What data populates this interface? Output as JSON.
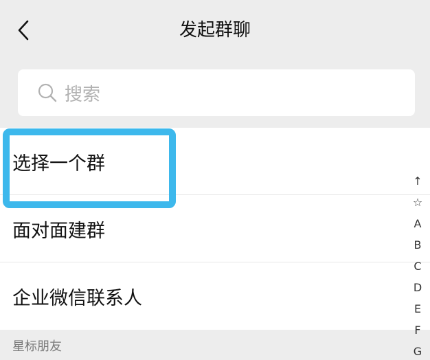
{
  "nav": {
    "title": "发起群聊"
  },
  "search": {
    "placeholder": "搜索"
  },
  "menu_items": [
    {
      "label": "选择一个群"
    },
    {
      "label": "面对面建群"
    },
    {
      "label": "企业微信联系人"
    }
  ],
  "section": {
    "title": "星标朋友"
  },
  "index": [
    "↑",
    "☆",
    "A",
    "B",
    "C",
    "D",
    "E",
    "F",
    "G"
  ],
  "colors": {
    "background": "#ededed",
    "highlight": "#3db8ec",
    "placeholder": "#b2b2b2"
  },
  "icons": {
    "back": "chevron-left-icon",
    "search": "search-icon"
  }
}
